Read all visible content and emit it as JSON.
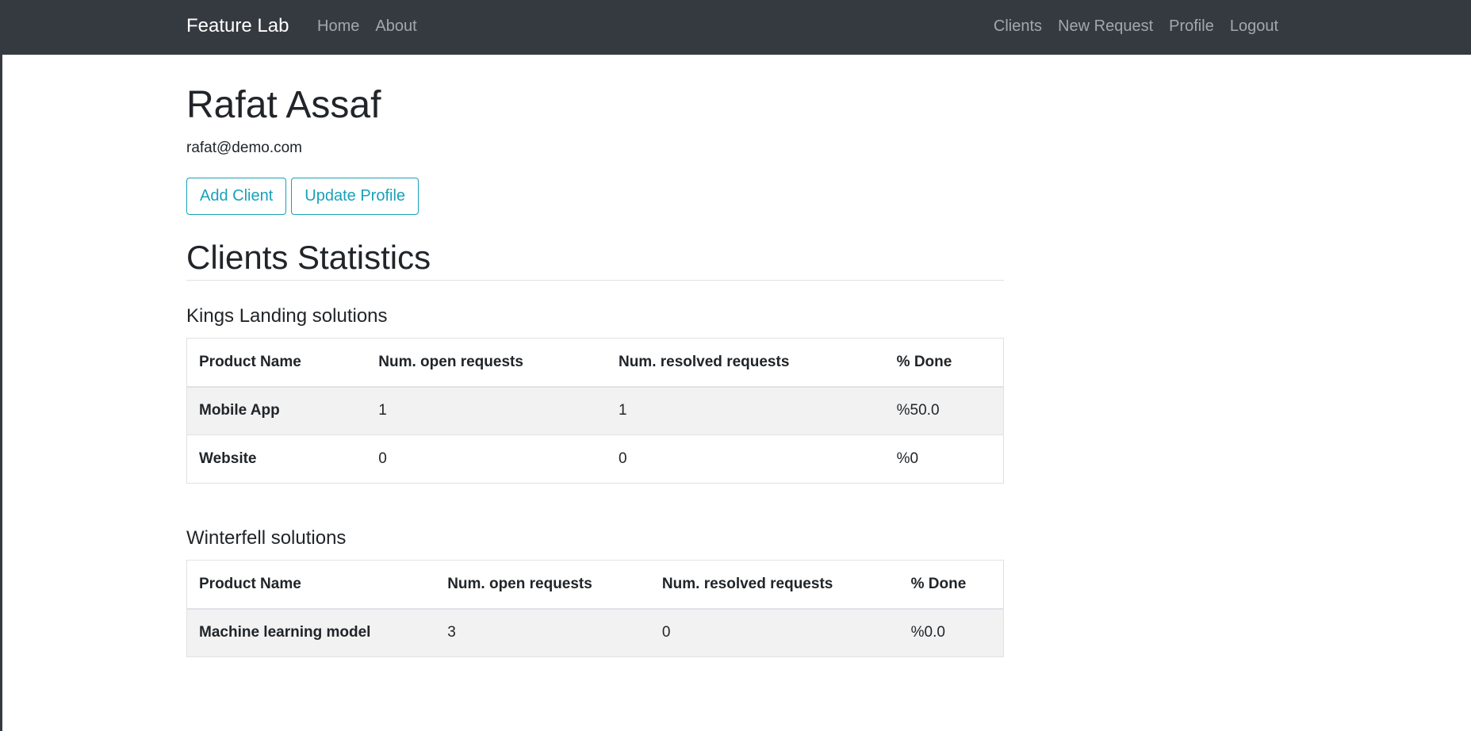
{
  "navbar": {
    "brand": "Feature Lab",
    "left_links": [
      "Home",
      "About"
    ],
    "right_links": [
      "Clients",
      "New Request",
      "Profile",
      "Logout"
    ]
  },
  "profile": {
    "name": "Rafat Assaf",
    "email": "rafat@demo.com",
    "add_client_label": "Add Client",
    "update_profile_label": "Update Profile"
  },
  "stats": {
    "title": "Clients Statistics",
    "headers": [
      "Product Name",
      "Num. open requests",
      "Num. resolved requests",
      "% Done"
    ],
    "clients": [
      {
        "name": "Kings Landing solutions",
        "rows": [
          [
            "Mobile App",
            "1",
            "1",
            "%50.0"
          ],
          [
            "Website",
            "0",
            "0",
            "%0"
          ]
        ]
      },
      {
        "name": "Winterfell solutions",
        "rows": [
          [
            "Machine learning model",
            "3",
            "0",
            "%0.0"
          ]
        ]
      }
    ]
  }
}
